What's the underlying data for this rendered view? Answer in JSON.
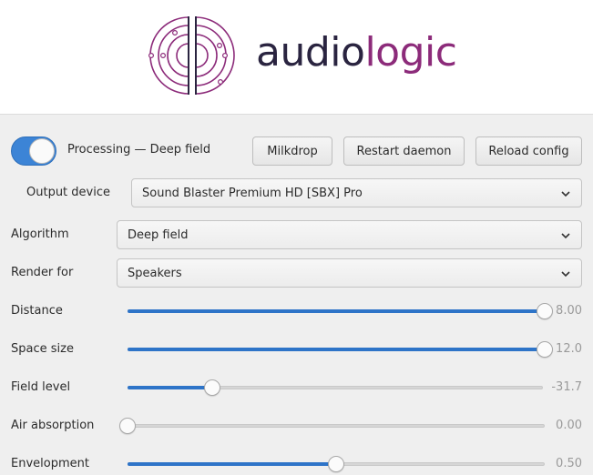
{
  "brand": {
    "name_part1": "audio",
    "name_part2": "logic",
    "logo_icon": "concentric-rings-logo-icon",
    "colors": {
      "dark": "#2a2440",
      "accent": "#8c2b7a"
    }
  },
  "toolbar": {
    "processing_enabled": true,
    "processing_label": "Processing — Deep field",
    "milkdrop_label": "Milkdrop",
    "restart_label": "Restart daemon",
    "reload_label": "Reload config"
  },
  "output_device": {
    "label": "Output device",
    "value": "Sound Blaster Premium HD [SBX] Pro"
  },
  "algorithm": {
    "label": "Algorithm",
    "value": "Deep field"
  },
  "render_for": {
    "label": "Render for",
    "value": "Speakers"
  },
  "sliders": [
    {
      "label": "Distance",
      "value_text": "8.00",
      "fraction": 1.0
    },
    {
      "label": "Space size",
      "value_text": "12.0",
      "fraction": 1.0
    },
    {
      "label": "Field level",
      "value_text": "-31.7",
      "fraction": 0.205
    },
    {
      "label": "Air absorption",
      "value_text": "0.00",
      "fraction": 0.0
    },
    {
      "label": "Envelopment",
      "value_text": "0.50",
      "fraction": 0.5
    }
  ],
  "colors": {
    "accent": "#2e74c8"
  }
}
